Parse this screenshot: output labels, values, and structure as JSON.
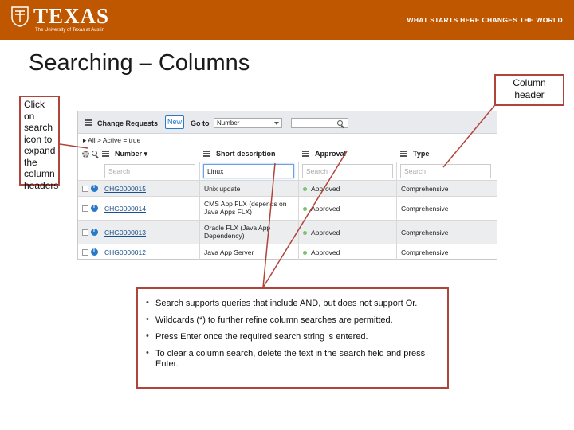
{
  "banner": {
    "logo_text": "TEXAS",
    "logo_sub": "The University of Texas at Austin",
    "tagline": "WHAT STARTS HERE CHANGES THE WORLD",
    "colors": {
      "burnt_orange": "#bf5700"
    }
  },
  "slide": {
    "title": "Searching – Columns"
  },
  "callouts": {
    "left": "Click on search icon to expand the column headers",
    "right": "Column header",
    "bullets": [
      "Search supports queries that include AND, but does not support Or.",
      "Wildcards (*) to further refine column searches are permitted.",
      "Press Enter once the required search string is entered.",
      "To clear a column search, delete the text in the search field and press Enter."
    ]
  },
  "screen": {
    "toolbar": {
      "title": "Change Requests",
      "new_label": "New",
      "goto_label": "Go to",
      "goto_selected": "Number"
    },
    "breadcrumb": "▸ All > Active = true",
    "columns": [
      {
        "label": "Number ▾"
      },
      {
        "label": "Short description"
      },
      {
        "label": "Approval"
      },
      {
        "label": "Type"
      }
    ],
    "search": {
      "number": "Search",
      "short_description": "Linux",
      "approval": "Search",
      "type": "Search"
    },
    "rows": [
      {
        "number": "CHG0000015",
        "short_description": "Unix update",
        "approval": "Approved",
        "type": "Comprehensive"
      },
      {
        "number": "CHG0000014",
        "short_description": "CMS App FLX (depends on Java Apps FLX)",
        "approval": "Approved",
        "type": "Comprehensive"
      },
      {
        "number": "CHG0000013",
        "short_description": "Oracle FLX (Java App Dependency)",
        "approval": "Approved",
        "type": "Comprehensive"
      },
      {
        "number": "CHG0000012",
        "short_description": "Java App Server",
        "approval": "Approved",
        "type": "Comprehensive"
      }
    ]
  }
}
